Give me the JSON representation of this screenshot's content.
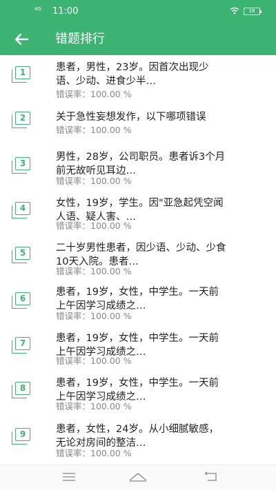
{
  "status_bar": {
    "signal": "4G",
    "time": "11:00",
    "battery": "28"
  },
  "header": {
    "title": "错题排行"
  },
  "colors": {
    "primary": "#3cb371",
    "text": "#222222",
    "subtext": "#888888"
  },
  "items": [
    {
      "rank": "1",
      "line1": "患者，男性，23岁。因首次出现少",
      "line2": "语、少动、进食少半…",
      "rate": "错误率：100.00 %"
    },
    {
      "rank": "2",
      "line1": "关于急性妄想发作，以下哪项错误",
      "line2": "",
      "rate": "错误率：100.00 %"
    },
    {
      "rank": "3",
      "line1": "男性，28岁，公司职员。患者诉3个月",
      "line2": "前无故听见耳边…",
      "rate": "错误率：100.00 %"
    },
    {
      "rank": "4",
      "line1": "女性，19岁，学生。因\"亚急起凭空闻",
      "line2": "人语、疑人害、…",
      "rate": "错误率：100.00 %"
    },
    {
      "rank": "5",
      "line1": "二十岁男性患者，因少语、少动、少食",
      "line2": "10天入院。患者…",
      "rate": "错误率：100.00 %"
    },
    {
      "rank": "6",
      "line1": "患者，19岁，女性，中学生。一天前",
      "line2": "上午因学习成绩之…",
      "rate": "错误率：100.00 %"
    },
    {
      "rank": "7",
      "line1": "患者，19岁，女性，中学生。一天前",
      "line2": "上午因学习成绩之…",
      "rate": "错误率：100.00 %"
    },
    {
      "rank": "8",
      "line1": "患者，19岁，女性，中学生。一天前",
      "line2": "上午因学习成绩之…",
      "rate": "错误率：100.00 %"
    },
    {
      "rank": "9",
      "line1": "患者，女性，24岁。从小细腻敏感，",
      "line2": "无论对房间的整洁…",
      "rate": "错误率：100.00 %"
    }
  ],
  "nav": {
    "menu_icon": "menu-icon",
    "home_icon": "home-icon",
    "back_icon": "back-icon"
  }
}
